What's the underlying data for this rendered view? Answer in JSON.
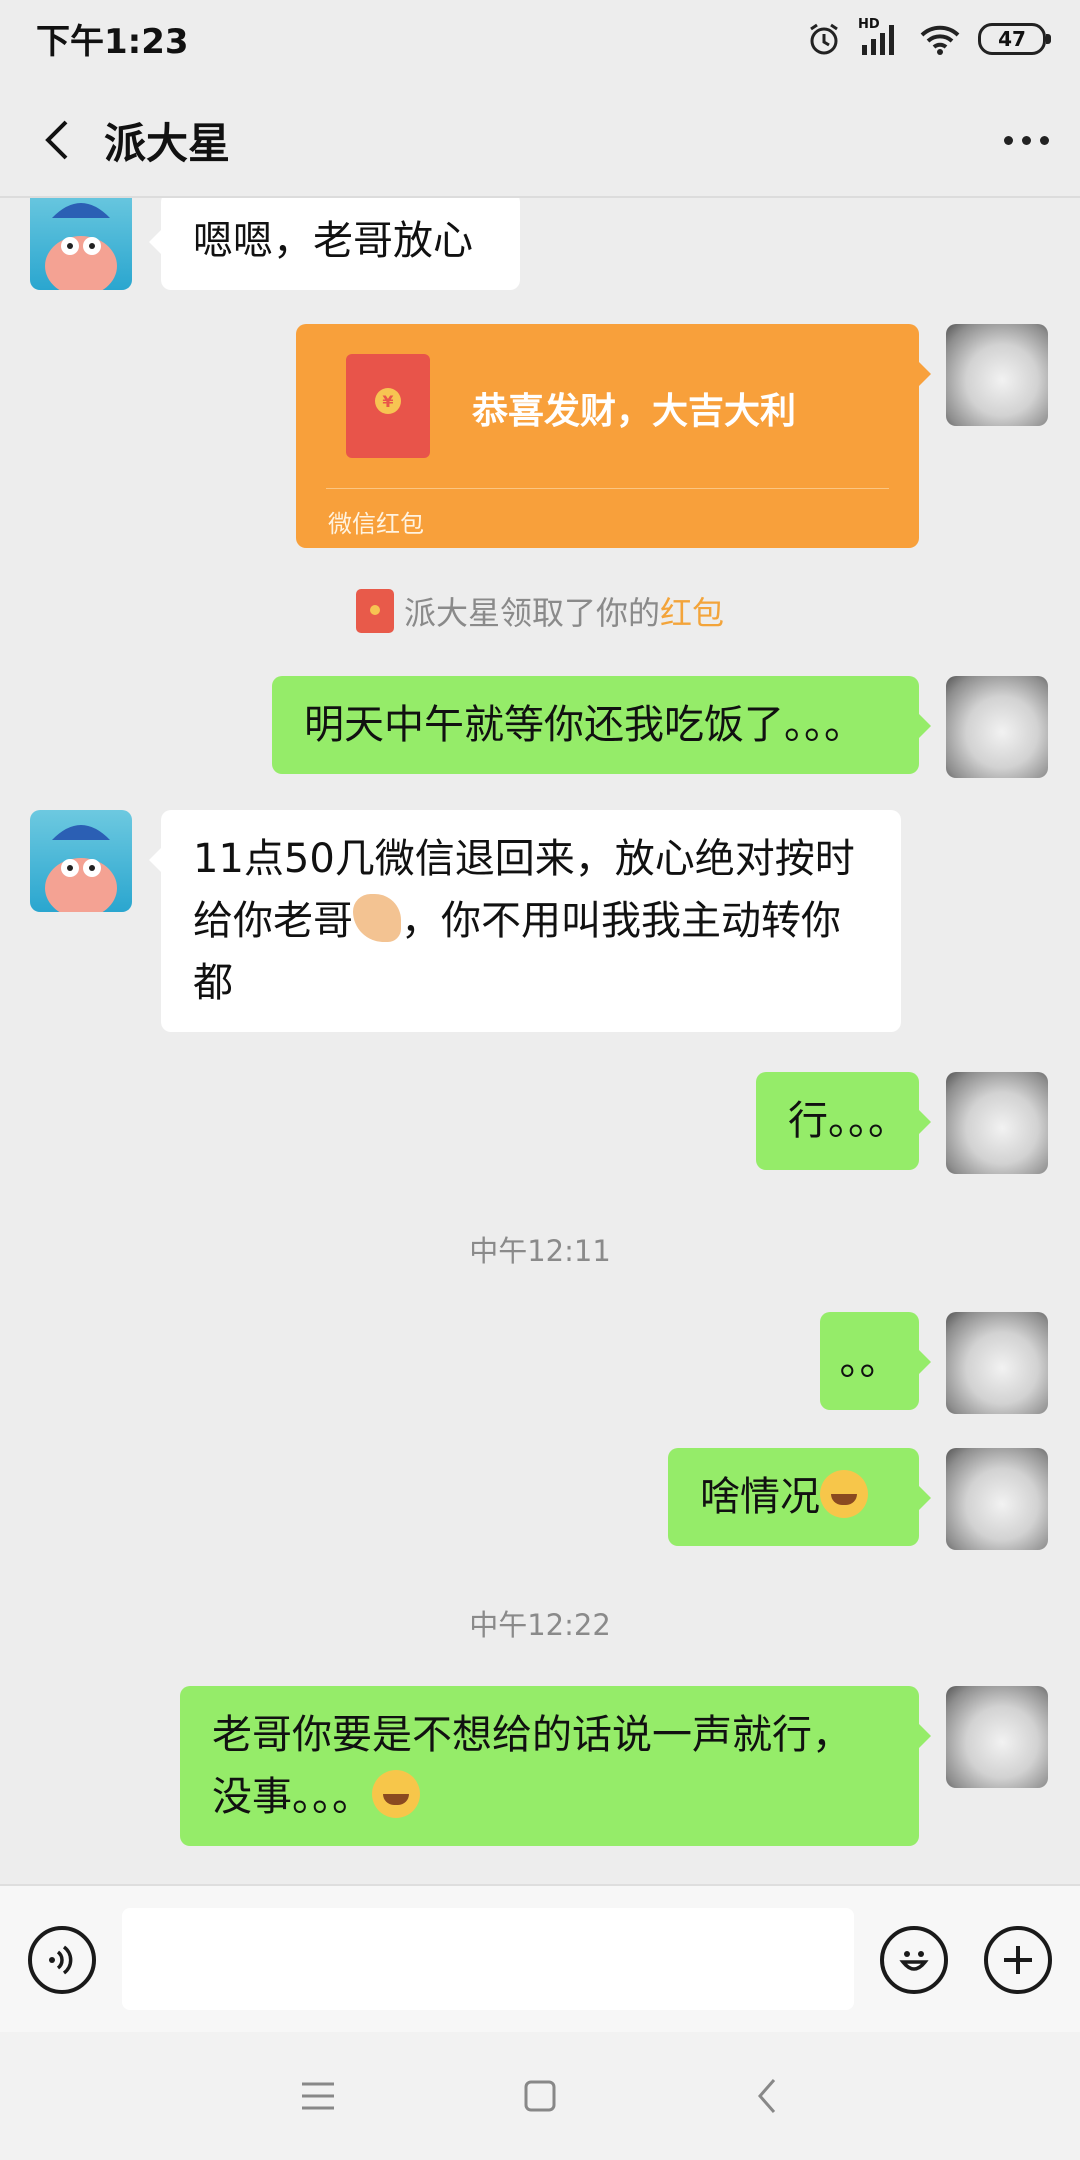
{
  "status_bar": {
    "time": "下午1:23",
    "battery": "47",
    "network_label": "HD"
  },
  "header": {
    "title": "派大星"
  },
  "messages": [
    {
      "text": "嗯嗯，老哥放心"
    },
    {
      "text": "明天中午就等你还我吃饭了。。。"
    },
    {
      "text_before": "11点50几微信退回来，放心绝对按时给你老哥",
      "text_after": "，你不用叫我我主动转你都"
    },
    {
      "text": "行。。。"
    },
    {
      "text": "。。"
    },
    {
      "text": "啥情况"
    },
    {
      "text": "老哥你要是不想给的话说一声就行，没事。。。"
    }
  ],
  "red_packet": {
    "greeting": "恭喜发财，大吉大利",
    "footer": "微信红包",
    "coin": "¥"
  },
  "system_notice": {
    "prefix": "派大星领取了你的",
    "highlight": "红包"
  },
  "timestamps": [
    "中午12:11",
    "中午12:22"
  ],
  "icons": {
    "back": "chevron-left-icon",
    "more": "more-dots-icon",
    "voice": "voice-icon",
    "emoji": "emoji-icon",
    "plus": "plus-icon"
  },
  "colors": {
    "sent_bubble": "#95ec69",
    "received_bubble": "#ffffff",
    "red_packet": "#f8a03b",
    "highlight": "#f3a43a"
  }
}
